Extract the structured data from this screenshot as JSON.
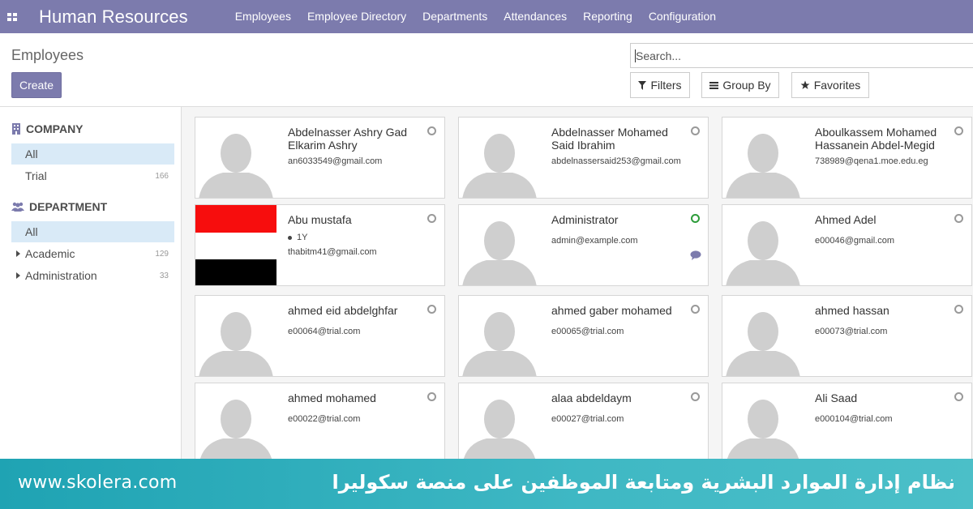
{
  "app": {
    "title": "Human Resources",
    "menu": [
      "Employees",
      "Employee Directory",
      "Departments",
      "Attendances",
      "Reporting",
      "Configuration"
    ]
  },
  "control_panel": {
    "breadcrumb": "Employees",
    "create_label": "Create",
    "search_placeholder": "Search...",
    "filters_label": "Filters",
    "group_by_label": "Group By",
    "favorites_label": "Favorites"
  },
  "side_panel": {
    "company": {
      "header": "COMPANY",
      "items": [
        {
          "label": "All",
          "count": ""
        },
        {
          "label": "Trial",
          "count": "166"
        }
      ]
    },
    "department": {
      "header": "DEPARTMENT",
      "items": [
        {
          "label": "All",
          "count": ""
        },
        {
          "label": "Academic",
          "count": "129"
        },
        {
          "label": "Administration",
          "count": "33"
        }
      ]
    }
  },
  "employees": [
    {
      "name": "Abdelnasser Ashry Gad Elkarim Ashry",
      "email": "an6033549@gmail.com",
      "tag": "",
      "status": "offline",
      "photo": "placeholder"
    },
    {
      "name": "Abdelnasser Mohamed Said Ibrahim",
      "email": "abdelnassersaid253@gmail.com",
      "tag": "",
      "status": "offline",
      "photo": "placeholder"
    },
    {
      "name": "Aboulkassem Mohamed Hassanein Abdel-Megid",
      "email": "738989@qena1.moe.edu.eg",
      "tag": "",
      "status": "offline",
      "photo": "placeholder"
    },
    {
      "name": "Abu mustafa",
      "email": "thabitm41@gmail.com",
      "tag": "1Y",
      "status": "offline",
      "photo": "flag"
    },
    {
      "name": "Administrator",
      "email": "admin@example.com",
      "tag": "",
      "status": "online",
      "photo": "placeholder"
    },
    {
      "name": "Ahmed Adel",
      "email": "e00046@gmail.com",
      "tag": "",
      "status": "offline",
      "photo": "placeholder"
    },
    {
      "name": "ahmed eid abdelghfar",
      "email": "e00064@trial.com",
      "tag": "",
      "status": "offline",
      "photo": "placeholder"
    },
    {
      "name": "ahmed gaber mohamed",
      "email": "e00065@trial.com",
      "tag": "",
      "status": "offline",
      "photo": "placeholder"
    },
    {
      "name": "ahmed hassan",
      "email": "e00073@trial.com",
      "tag": "",
      "status": "offline",
      "photo": "placeholder"
    },
    {
      "name": "ahmed mohamed",
      "email": "e00022@trial.com",
      "tag": "",
      "status": "offline",
      "photo": "placeholder"
    },
    {
      "name": "alaa abdeldaym",
      "email": "e00027@trial.com",
      "tag": "",
      "status": "offline",
      "photo": "placeholder"
    },
    {
      "name": "Ali Saad",
      "email": "e000104@trial.com",
      "tag": "",
      "status": "offline",
      "photo": "placeholder"
    }
  ],
  "colors": {
    "topbar": "#7c7bad",
    "active_filter": "#d9eaf7",
    "status_online": "#2d9c3a",
    "banner": "#2eaebb"
  },
  "banner": {
    "url": "www.skolera.com",
    "caption": "نظام إدارة الموارد البشرية ومتابعة الموظفين على منصة سكوليرا"
  }
}
